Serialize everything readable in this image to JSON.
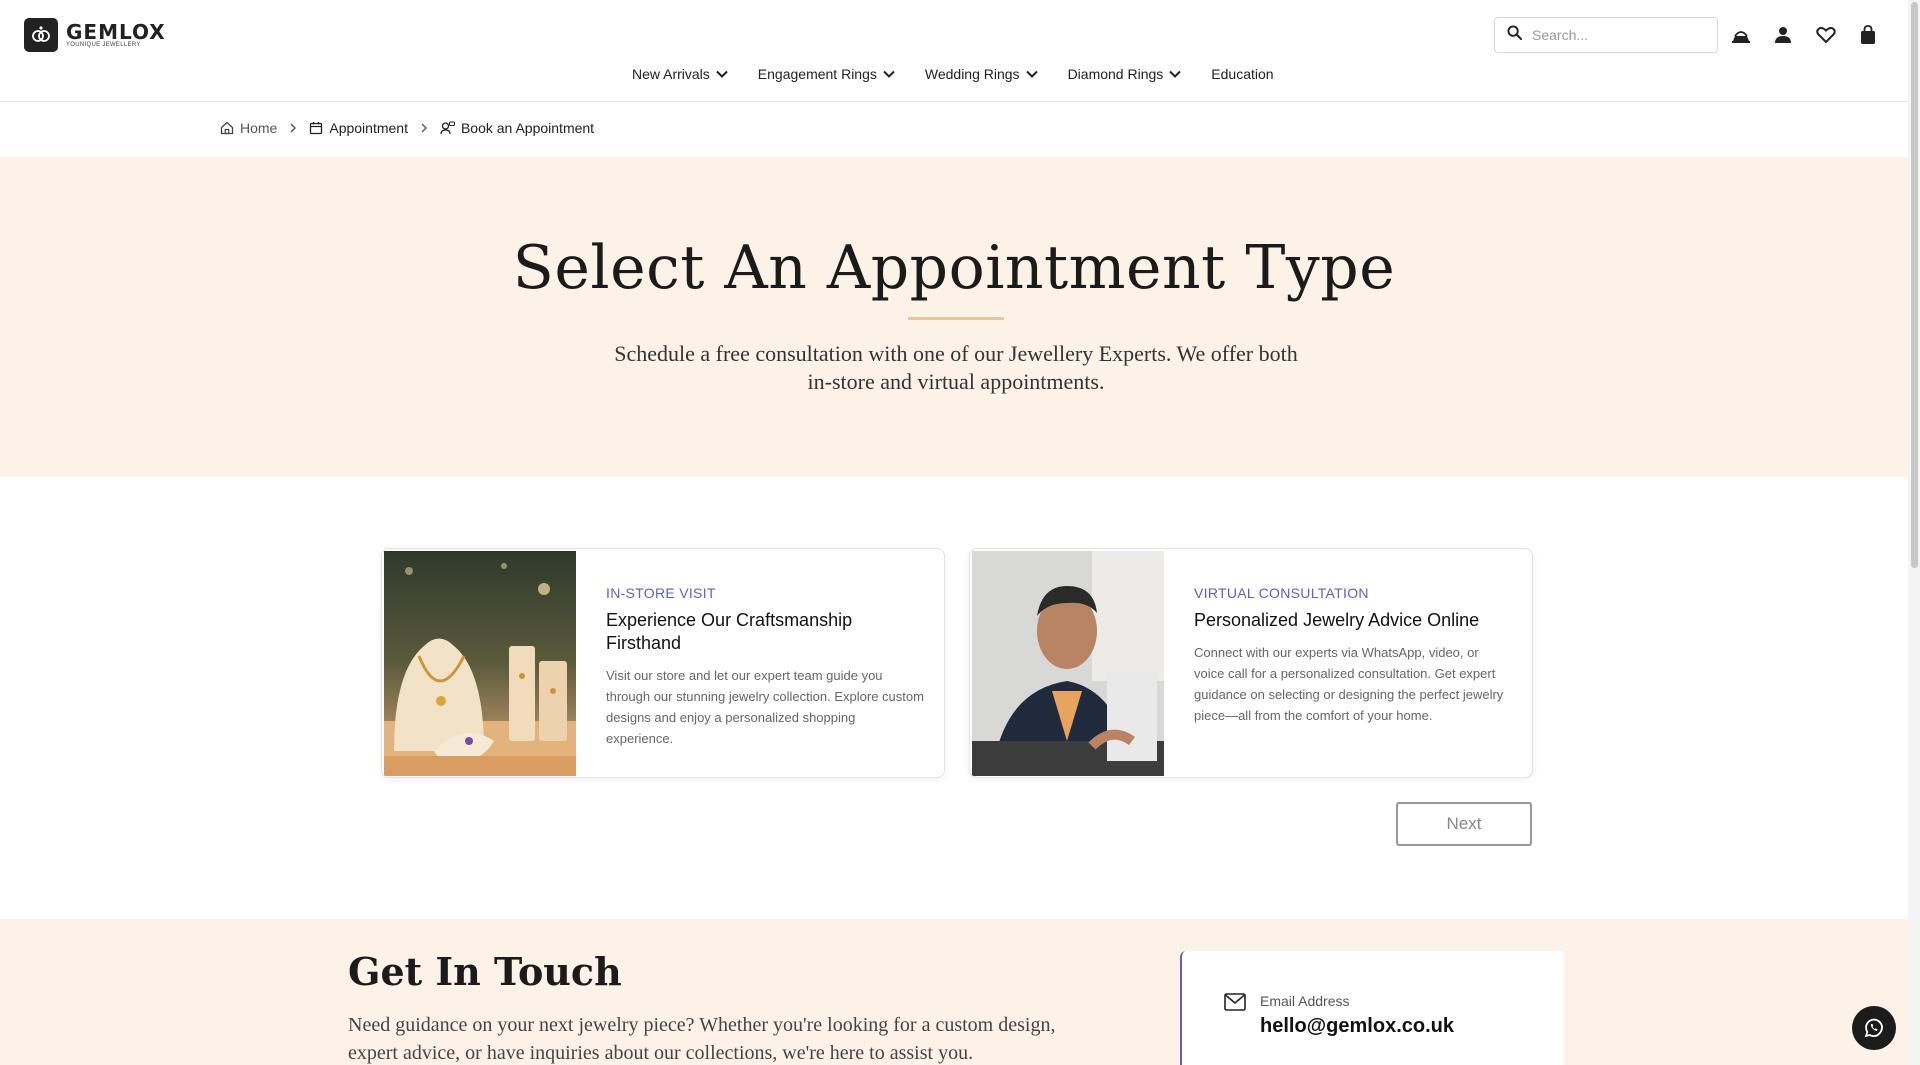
{
  "brand": {
    "name": "GEMLOX",
    "tagline": "YOUNIQUE JEWELLERY"
  },
  "search": {
    "placeholder": "Search..."
  },
  "header_icons": [
    "ring-box-icon",
    "user-icon",
    "heart-icon",
    "bag-icon"
  ],
  "nav": {
    "items": [
      {
        "label": "New Arrivals",
        "has_dropdown": true
      },
      {
        "label": "Engagement Rings",
        "has_dropdown": true
      },
      {
        "label": "Wedding Rings",
        "has_dropdown": true
      },
      {
        "label": "Diamond Rings",
        "has_dropdown": true
      },
      {
        "label": "Education",
        "has_dropdown": false
      }
    ]
  },
  "breadcrumb": {
    "items": [
      {
        "label": "Home",
        "icon": "home-icon"
      },
      {
        "label": "Appointment",
        "icon": "calendar-icon"
      },
      {
        "label": "Book an Appointment",
        "icon": "person-chat-icon"
      }
    ]
  },
  "hero": {
    "title": "Select An Appointment Type",
    "subtitle": "Schedule a free consultation with one of our Jewellery Experts. We offer both in-store and virtual appointments."
  },
  "cards": [
    {
      "eyebrow": "IN-STORE VISIT",
      "title": "Experience Our Craftsmanship Firsthand",
      "description": "Visit our store and let our expert team guide you through our stunning jewelry collection. Explore custom designs and enjoy a personalized shopping experience."
    },
    {
      "eyebrow": "VIRTUAL CONSULTATION",
      "title": "Personalized Jewelry Advice Online",
      "description": "Connect with our experts via WhatsApp, video, or voice call for a personalized consultation. Get expert guidance on selecting or designing the perfect jewelry piece—all from the comfort of your home."
    }
  ],
  "next_button": {
    "label": "Next"
  },
  "contact": {
    "title": "Get In Touch",
    "text": "Need guidance on your next jewelry piece? Whether you're looking for a custom design, expert advice, or have inquiries about our collections, we're here to assist you.",
    "email_label": "Email Address",
    "email_value": "hello@gemlox.co.uk"
  },
  "colors": {
    "hero_bg": "#fcf2e7",
    "accent_line": "#e5c79c",
    "eyebrow": "#5b5fc7"
  }
}
